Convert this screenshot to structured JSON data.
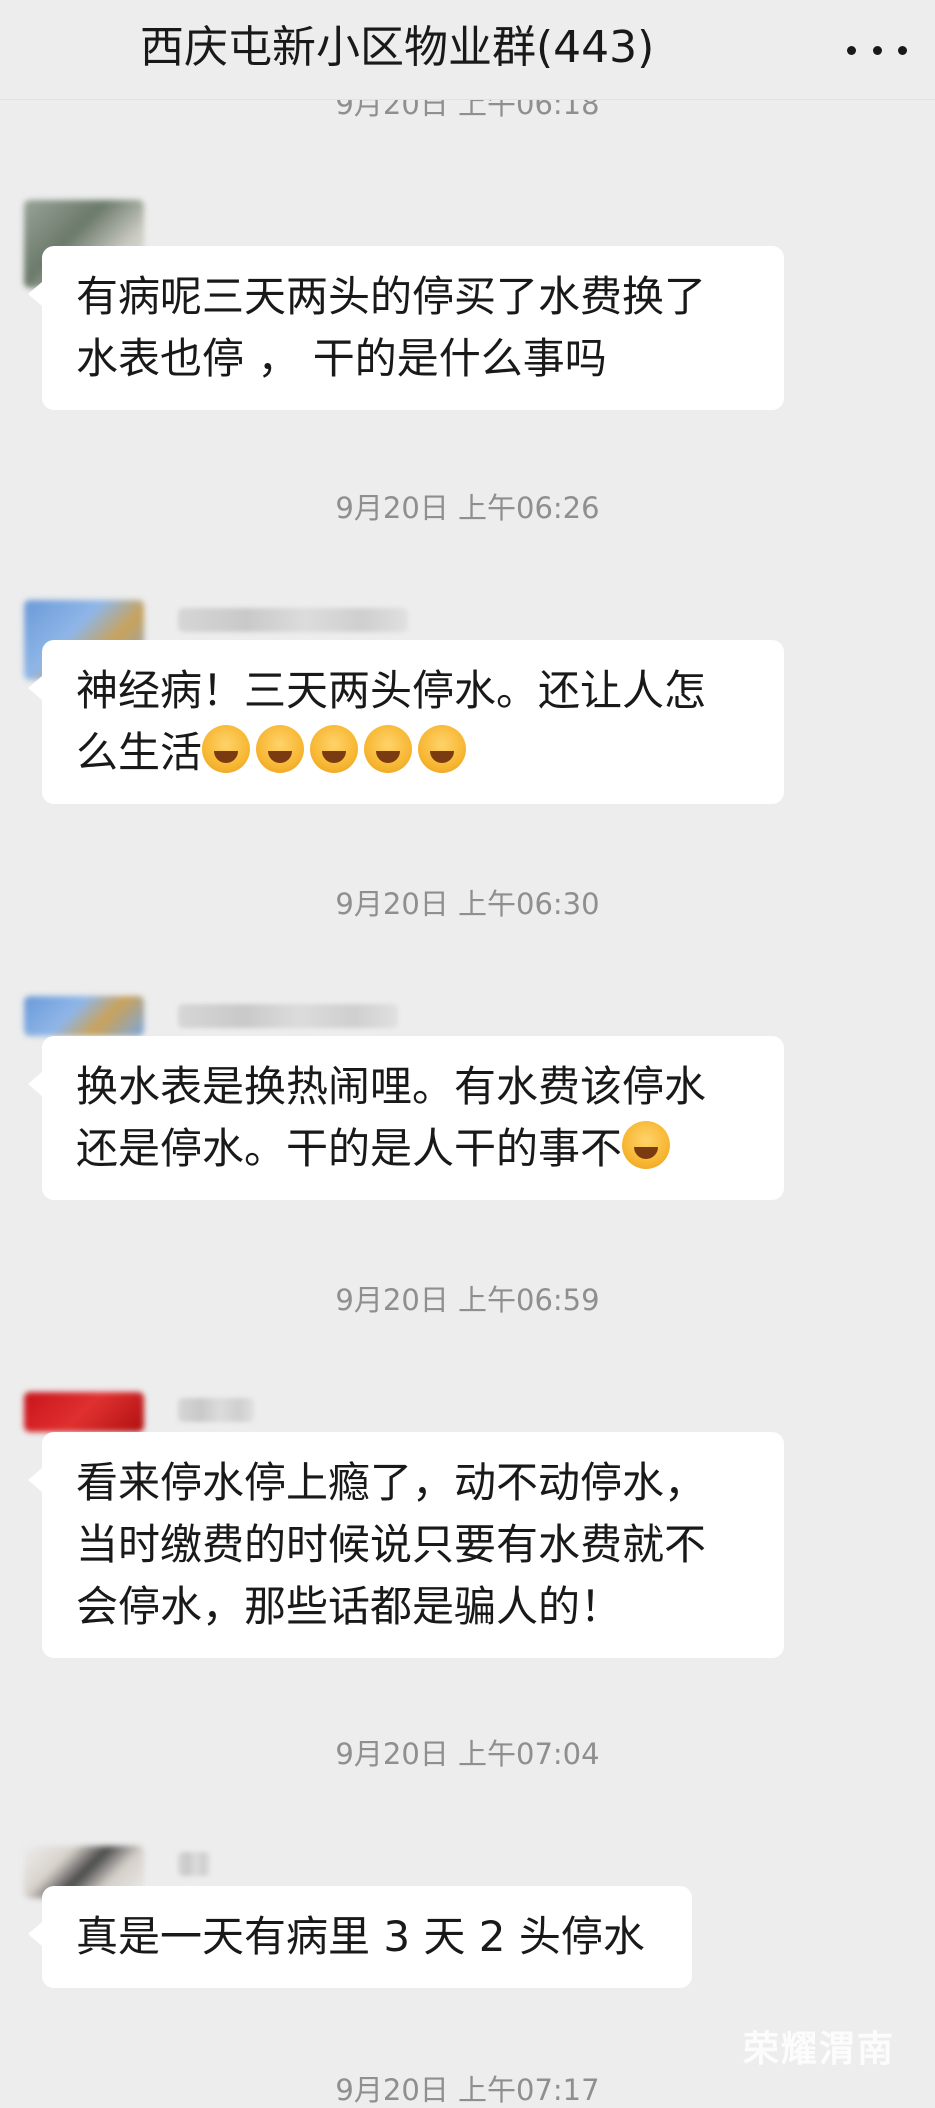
{
  "header": {
    "title": "西庆屯新小区物业群(443)",
    "more_icon": "more-dots-icon"
  },
  "messages": [
    {
      "timestamp_above": "9月20日 上午06:18",
      "lines": [
        "有病呢三天两头的停买了水费换了",
        "水表也停 ， 干的是什么事吗"
      ],
      "emoji_count": 0
    },
    {
      "timestamp_above": "9月20日 上午06:26",
      "lines": [
        "神经病！三天两头停水。还让人怎",
        "么生活"
      ],
      "emoji": "crying-laughing-face",
      "emoji_count": 5
    },
    {
      "timestamp_above": "9月20日 上午06:30",
      "lines": [
        "换水表是换热闹哩。有水费该停水",
        "还是停水。干的是人干的事不"
      ],
      "emoji": "tired-face",
      "emoji_count": 1
    },
    {
      "timestamp_above": "9月20日 上午06:59",
      "lines": [
        "看来停水停上瘾了，动不动停水，",
        "当时缴费的时候说只要有水费就不",
        "会停水，那些话都是骗人的！"
      ],
      "emoji_count": 0
    },
    {
      "timestamp_above": "9月20日 上午07:04",
      "lines": [
        "真是一天有病里 3 天 2 头停水"
      ],
      "emoji_count": 0
    }
  ],
  "footer_timestamp": "9月20日 上午07:17",
  "watermark": "荣耀渭南",
  "colors": {
    "background": "#ededed",
    "bubble": "#ffffff",
    "timestamp_text": "#8f8f8f"
  }
}
